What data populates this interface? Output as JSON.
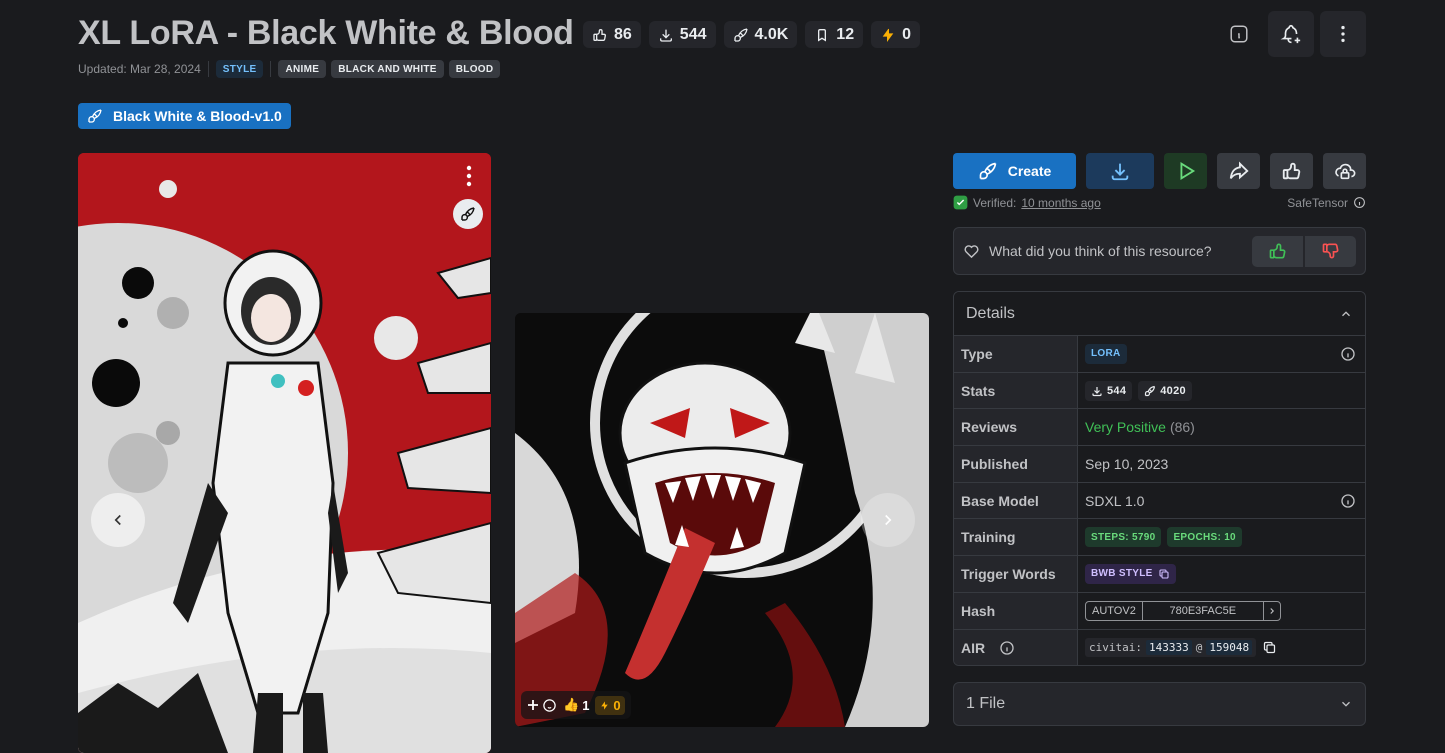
{
  "header": {
    "title": "XL LoRA - Black White & Blood",
    "stats": {
      "likes": "86",
      "downloads": "544",
      "generations": "4.0K",
      "bookmarks": "12",
      "buzz": "0"
    },
    "updated": "Updated: Mar 28, 2024",
    "tags": [
      "STYLE",
      "ANIME",
      "BLACK AND WHITE",
      "BLOOD"
    ]
  },
  "version": {
    "label": "Black White & Blood-v1.0"
  },
  "gallery": {
    "card2_reactions": {
      "likes": "1",
      "buzz": "0"
    }
  },
  "actions": {
    "create_label": "Create",
    "verified_text": "Verified:",
    "verified_time": "10 months ago",
    "file_format": "SafeTensor"
  },
  "feedback": {
    "question": "What did you think of this resource?"
  },
  "details": {
    "heading": "Details",
    "rows": {
      "type": {
        "label": "Type",
        "value": "LORA"
      },
      "stats": {
        "label": "Stats",
        "downloads": "544",
        "generations": "4020"
      },
      "reviews": {
        "label": "Reviews",
        "value": "Very Positive",
        "count": "(86)"
      },
      "published": {
        "label": "Published",
        "value": "Sep 10, 2023"
      },
      "base_model": {
        "label": "Base Model",
        "value": "SDXL 1.0"
      },
      "training": {
        "label": "Training",
        "steps": "STEPS: 5790",
        "epochs": "EPOCHS: 10"
      },
      "trigger_words": {
        "label": "Trigger Words",
        "value": "BWB STYLE"
      },
      "hash": {
        "label": "Hash",
        "type": "AUTOV2",
        "value": "780E3FAC5E"
      },
      "air": {
        "label": "AIR",
        "prefix": "civitai:",
        "model_id": "143333",
        "at": "@",
        "version_id": "159048"
      }
    }
  },
  "files": {
    "label": "1 File"
  },
  "colors": {
    "background": "#1a1b1e",
    "surface": "#25262b",
    "border": "#373a40",
    "accent_blue": "#1971c2",
    "positive_green": "#40c057",
    "buzz_yellow": "#fab005"
  }
}
